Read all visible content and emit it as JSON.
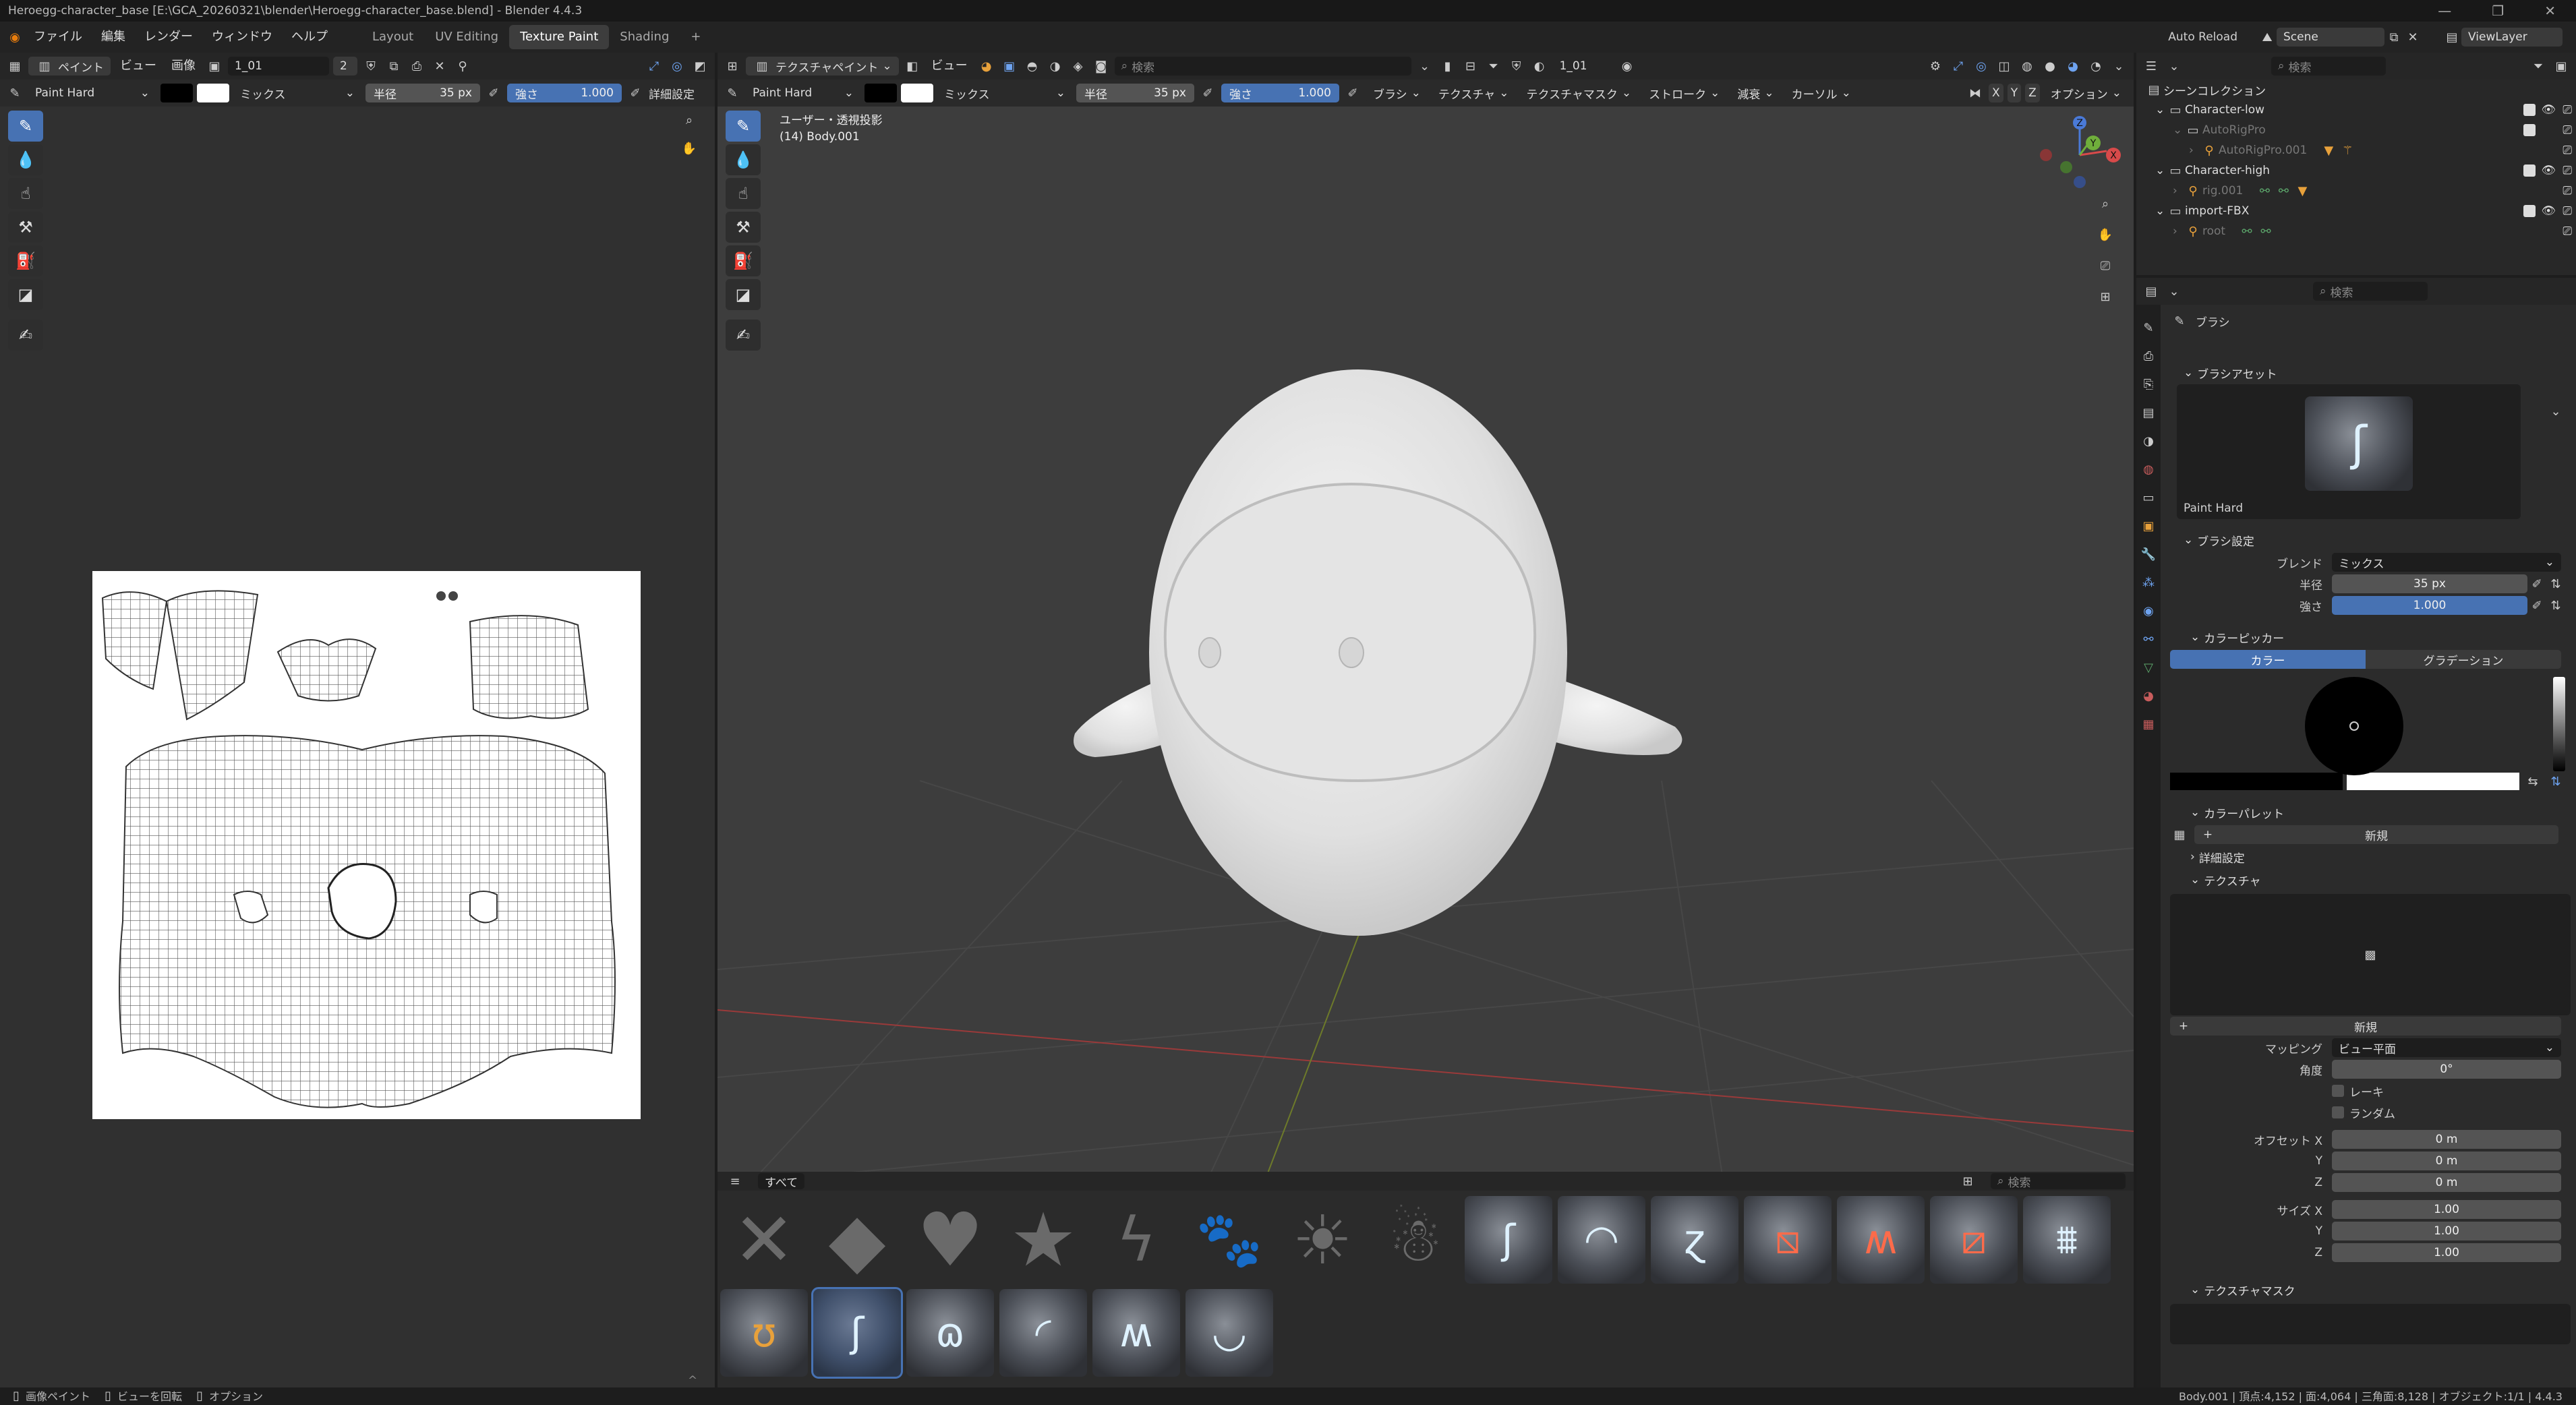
{
  "window": {
    "title": "Heroegg-character_base [E:\\GCA_20260321\\blender\\Heroegg-character_base.blend] - Blender 4.4.3",
    "controls": [
      "—",
      "❐",
      "✕"
    ]
  },
  "topmenu": {
    "items": [
      "ファイル",
      "編集",
      "レンダー",
      "ウィンドウ",
      "ヘルプ"
    ],
    "workspaces": [
      "Layout",
      "UV Editing",
      "Texture Paint",
      "Shading",
      "+"
    ],
    "auto_reload": "Auto Reload",
    "scene": "Scene",
    "view_layer": "ViewLayer"
  },
  "image_editor": {
    "mode": "ペイント",
    "menus": [
      "ビュー",
      "画像"
    ],
    "image_name": "1_01",
    "users": "2",
    "brush_name": "Paint Hard",
    "blend": "ミックス",
    "radius_label": "半径",
    "radius_value": "35 px",
    "strength_label": "強さ",
    "strength_value": "1.000",
    "details": "詳細設定"
  },
  "viewport": {
    "mode": "テクスチャペイント",
    "view_menu": "ビュー",
    "search_placeholder": "検索",
    "image_name": "1_01",
    "brush_name": "Paint Hard",
    "blend": "ミックス",
    "radius_label": "半径",
    "radius_value": "35 px",
    "strength_label": "強さ",
    "strength_value": "1.000",
    "menus": [
      "ブラシ",
      "テクスチャ",
      "テクスチャマスク",
      "ストローク",
      "減衰",
      "カーソル"
    ],
    "axes_lock": [
      "X",
      "Y",
      "Z"
    ],
    "options": "オプション",
    "overlay_title": "ユーザー・透視投影",
    "overlay_object": "(14) Body.001",
    "gizmo": [
      "X",
      "Y",
      "Z"
    ]
  },
  "asset_shelf": {
    "tab": "すべて",
    "search_placeholder": "検索"
  },
  "outliner": {
    "search_placeholder": "検索",
    "root": "シーンコレクション",
    "items": [
      {
        "label": "Character-low",
        "indent": 1,
        "icon": "collection"
      },
      {
        "label": "AutoRigPro",
        "indent": 2,
        "icon": "collection",
        "dim": true
      },
      {
        "label": "AutoRigPro.001",
        "indent": 3,
        "icon": "armature",
        "dim": true
      },
      {
        "label": "Character-high",
        "indent": 1,
        "icon": "collection"
      },
      {
        "label": "rig.001",
        "indent": 2,
        "icon": "armature",
        "dim": true
      },
      {
        "label": "import-FBX",
        "indent": 1,
        "icon": "collection"
      },
      {
        "label": "root",
        "indent": 2,
        "icon": "armature",
        "dim": true
      }
    ]
  },
  "properties": {
    "search_placeholder": "検索",
    "tab_title": "ブラシ",
    "asset_section": "ブラシアセット",
    "asset_name": "Paint Hard",
    "settings_section": "ブラシ設定",
    "blend_label": "ブレンド",
    "blend_value": "ミックス",
    "radius_label": "半径",
    "radius_value": "35 px",
    "strength_label": "強さ",
    "strength_value": "1.000",
    "color_picker_section": "カラーピッカー",
    "color_tab": "カラー",
    "gradient_tab": "グラデーション",
    "palette_section": "カラーパレット",
    "palette_new": "新規",
    "advanced_section": "詳細設定",
    "texture_section": "テクスチャ",
    "texture_new": "新規",
    "mapping_label": "マッピング",
    "mapping_value": "ビュー平面",
    "angle_label": "角度",
    "angle_value": "0°",
    "rake_label": "レーキ",
    "random_label": "ランダム",
    "offset_label": "オフセット X",
    "offset_x": "0 m",
    "y_label": "Y",
    "offset_y": "0 m",
    "z_label": "Z",
    "offset_z": "0 m",
    "size_label": "サイズ X",
    "size_x": "1.00",
    "size_y": "1.00",
    "size_z": "1.00",
    "mask_section": "テクスチャマスク"
  },
  "statusbar": {
    "left_items": [
      "画像ペイント",
      "ビューを回転",
      "オプション"
    ],
    "stats": "Body.001 | 頂点:4,152 | 面:4,064 | 三角面:8,128 | オブジェクト:1/1 | 4.4.3"
  },
  "colors": {
    "accent": "#4772b3",
    "primary_color": "#000000",
    "secondary_color": "#ffffff"
  }
}
